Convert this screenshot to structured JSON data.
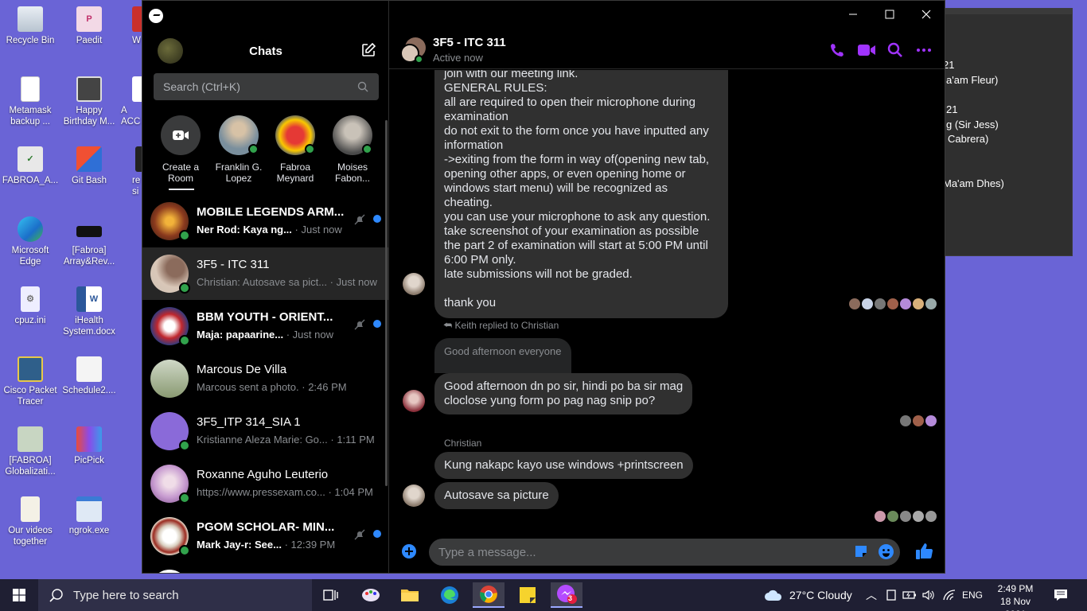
{
  "desktop": {
    "icons": [
      {
        "label": "Recycle Bin",
        "name": "recycle-bin-icon"
      },
      {
        "label": "Paedit",
        "name": "paedit-icon"
      },
      {
        "label": "W",
        "name": "word-shortcut-icon"
      },
      {
        "label": "Metamask backup ...",
        "name": "text-file-icon"
      },
      {
        "label": "Happy Birthday M...",
        "name": "video-file-icon"
      },
      {
        "label": "A ACC",
        "name": "access-file-icon"
      },
      {
        "label": "FABROA_A...",
        "name": "packet-file-icon"
      },
      {
        "label": "Git Bash",
        "name": "git-bash-icon"
      },
      {
        "label": "re si",
        "name": "shortcut-icon"
      },
      {
        "label": "Microsoft Edge",
        "name": "edge-icon"
      },
      {
        "label": "[Fabroa] Array&Rev...",
        "name": "exe-file-icon"
      },
      {
        "label": "cpuz.ini",
        "name": "ini-file-icon"
      },
      {
        "label": "iHealth System.docx",
        "name": "docx-file-icon"
      },
      {
        "label": "Cisco Packet Tracer",
        "name": "cisco-icon"
      },
      {
        "label": "Schedule2....",
        "name": "image-file-icon"
      },
      {
        "label": "[FABROA] Globalizati...",
        "name": "image-file-icon"
      },
      {
        "label": "PicPick",
        "name": "picpick-icon"
      },
      {
        "label": "Our videos together",
        "name": "folder-icon"
      },
      {
        "label": "ngrok.exe",
        "name": "ngrok-icon"
      }
    ]
  },
  "bg_window": {
    "lines": [
      "21",
      "a'am Fleur)",
      "21",
      "g (Sir Jess)",
      "Cabrera)",
      "Ma'am Dhes)"
    ]
  },
  "sidebar": {
    "title": "Chats",
    "search_placeholder": "Search (Ctrl+K)",
    "stories": [
      {
        "label": "Create a Room"
      },
      {
        "label": "Franklin G. Lopez"
      },
      {
        "label": "Fabroa Meynard"
      },
      {
        "label": "Moises Fabon..."
      }
    ],
    "chats": [
      {
        "name": "MOBILE LEGENDS ARM...",
        "preview": "Ner Rod: Kaya ng...",
        "time": "· Just now",
        "unread": true,
        "muted": true,
        "av_color": "#8b3a1e"
      },
      {
        "name": "3F5 - ITC 311",
        "preview": "Christian: Autosave sa pict...",
        "time": "· Just now",
        "unread": false,
        "muted": false,
        "av_color": "#b59a86"
      },
      {
        "name": "BBM YOUTH - ORIENT...",
        "preview": "Maja: papaarine...",
        "time": "· Just now",
        "unread": true,
        "muted": true,
        "av_color": "#c0272d"
      },
      {
        "name": "Marcous De Villa",
        "preview": "Marcous sent a photo.",
        "time": "· 2:46 PM",
        "unread": false,
        "muted": false,
        "av_color": "#6d7a5a"
      },
      {
        "name": "3F5_ITP 314_SIA 1",
        "preview": "Kristianne Aleza Marie: Go...",
        "time": "· 1:11 PM",
        "unread": false,
        "muted": false,
        "av_color": "#8a6ad9"
      },
      {
        "name": "Roxanne Aguho Leuterio",
        "preview": "https://www.pressexam.co...",
        "time": "· 1:04 PM",
        "unread": false,
        "muted": false,
        "av_color": "#c79bd0"
      },
      {
        "name": "PGOM SCHOLAR- MIN...",
        "preview": "Mark Jay-r: See...",
        "time": "· 12:39 PM",
        "unread": true,
        "muted": true,
        "av_color": "#d9cfc0"
      }
    ]
  },
  "conversation": {
    "title": "3F5 - ITC 311",
    "status": "Active now",
    "big_message_lines": [
      "join with our meeting link.",
      "GENERAL RULES:",
      "all are required to open their microphone during",
      "examination",
      "do not exit to the form once you have inputted any",
      "information",
      "->exiting from the form in way of(opening new tab,",
      "opening other apps, or even opening home or",
      "windows start menu) will be recognized as cheating.",
      "you can use your microphone to ask any question.",
      "take screenshot of your examination as possible",
      "the part 2 of examination will start at 5:00 PM until",
      "6:00 PM only.",
      "late submissions will not be graded.",
      "",
      "thank you"
    ],
    "reply_label": "Keith replied to Christian",
    "replied_text": "Good afternoon everyone",
    "reply_message_lines": [
      "Good afternoon dn po sir, hindi po ba sir mag",
      "cloclose yung form po pag nag snip po?"
    ],
    "sender_name": "Christian",
    "msg_1": "Kung nakapc kayo use windows +printscreen",
    "msg_2": "Autosave sa picture",
    "input_placeholder": "Type a message..."
  },
  "taskbar": {
    "search_placeholder": "Type here to search",
    "weather": "27°C  Cloudy",
    "lang": "ENG",
    "time": "2:49 PM",
    "date": "18 Nov 2021",
    "messenger_badge": "3"
  },
  "colors": {
    "accent_purple": "#a033ff",
    "desktop_bg": "#6a64d6",
    "online_green": "#31a24c",
    "unread_blue": "#2e89ff"
  }
}
